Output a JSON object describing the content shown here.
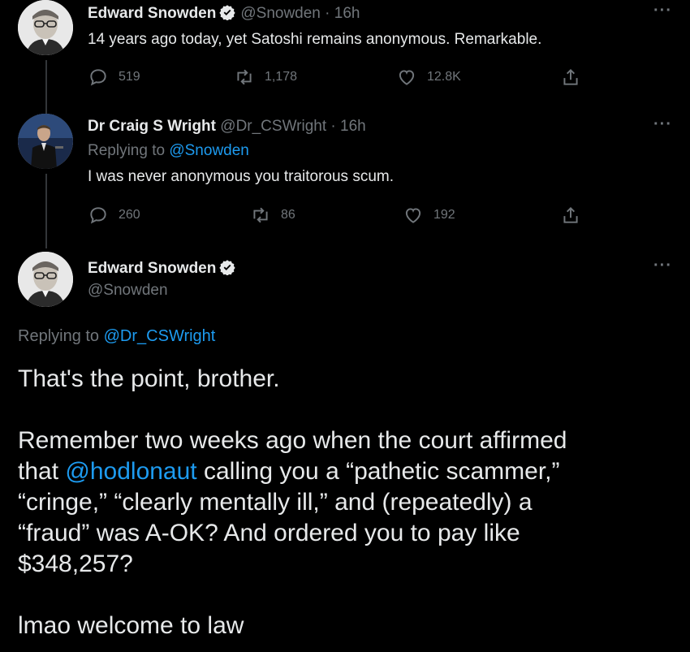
{
  "tweets": [
    {
      "name": "Edward Snowden",
      "handle": "@Snowden",
      "time": "16h",
      "text": "14 years ago today, yet Satoshi remains anonymous. Remarkable.",
      "replies": "519",
      "retweets": "1,178",
      "likes": "12.8K",
      "avatar_icon": "person-glasses-avatar",
      "more_icon": "more-icon"
    },
    {
      "name": "Dr Craig S Wright",
      "handle": "@Dr_CSWright",
      "time": "16h",
      "replying_prefix": "Replying to",
      "replying_to": "@Snowden",
      "text": "I was never anonymous you traitorous scum.",
      "replies": "260",
      "retweets": "86",
      "likes": "192",
      "avatar_icon": "speaker-avatar"
    }
  ],
  "main_tweet": {
    "name": "Edward Snowden",
    "handle": "@Snowden",
    "replying_prefix": "Replying to",
    "replying_to": "@Dr_CSWright",
    "line1": "That's the point, brother.",
    "para2_line1": "Remember two weeks ago when the court affirmed",
    "para2_line2_prefix": "that",
    "para2_mention": "@hodlonaut",
    "para2_line2_suffix": "calling you a “pathetic scammer,”",
    "para2_line3": "“cringe,” “clearly mentally ill,” and (repeatedly) a",
    "para2_line4": "“fraud” was A-OK? And ordered you to pay like",
    "para2_line5": "$348,257?",
    "line_last": "lmao welcome to law"
  },
  "ui": {
    "dot": "·",
    "more": "···"
  },
  "colors": {
    "background": "#000000",
    "text": "#e7e9ea",
    "muted": "#71767b",
    "link": "#1d9bf0",
    "thread_line": "#333639"
  }
}
